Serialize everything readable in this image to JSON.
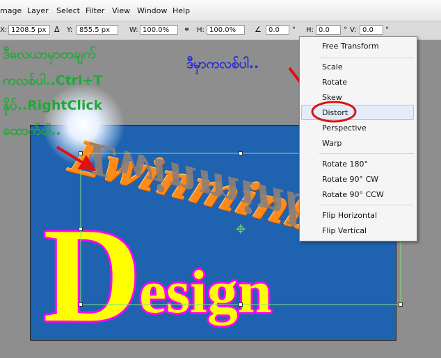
{
  "menubar": {
    "items": [
      "mage",
      "Layer",
      "Select",
      "Filter",
      "View",
      "Window",
      "Help"
    ]
  },
  "options": {
    "x_label": "X:",
    "x_value": "1208.5 px",
    "y_label": "Y:",
    "y_value": "855.5 px",
    "w_label": "W:",
    "w_value": "100.0%",
    "h_label": "H:",
    "h_value": "100.0%",
    "angle_value": "0.0",
    "deg": "°",
    "hskew_label": "H:",
    "hskew_value": "0.0",
    "vskew_label": "V:",
    "vskew_value": "0.0"
  },
  "annotations": {
    "left_line1": "ဒီလေယာမှာတချက်",
    "left_line2": "ကလစ်ပါ..Ctrl+T",
    "left_line3": "နှိပ်..RightClick",
    "left_line4": "ထောက်ပါ..",
    "top_note": "ဒီမှာကလစ်ပါ.."
  },
  "artwork": {
    "wave_text": "Lwinminbo",
    "design_first": "D",
    "design_rest": "esign"
  },
  "context_menu": {
    "items": [
      {
        "label": "Free Transform"
      },
      {
        "label": "Scale"
      },
      {
        "label": "Rotate"
      },
      {
        "label": "Skew"
      },
      {
        "label": "Distort"
      },
      {
        "label": "Perspective"
      },
      {
        "label": "Warp"
      },
      {
        "label": "Rotate 180°"
      },
      {
        "label": "Rotate 90° CW"
      },
      {
        "label": "Rotate 90° CCW"
      },
      {
        "label": "Flip Horizontal"
      },
      {
        "label": "Flip Vertical"
      }
    ]
  },
  "colors": {
    "annotation_green": "#22a83a",
    "annotation_blue": "#2b2bd6",
    "arrow_red": "#e01010",
    "canvas_blue": "#1f62b0",
    "wave_orange": "#ff8a1a",
    "design_yellow": "#ffff00",
    "design_outline": "#ff00ff"
  }
}
